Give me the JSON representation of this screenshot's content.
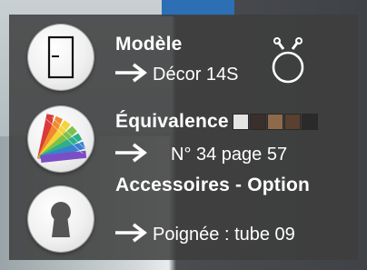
{
  "model": {
    "title": "Modèle",
    "value": "Décor 14S"
  },
  "equivalence": {
    "title": "Équivalence",
    "value": "N° 34 page 57",
    "swatches": [
      "#e4e4e4",
      "#3b2f2c",
      "#8f6a4a",
      "#5a4030",
      "#2a2a2a"
    ]
  },
  "accessories": {
    "title": "Accessoires - Option",
    "value": "Poignée : tube 09"
  },
  "icons": {
    "door": "door-icon",
    "palette": "color-fan-icon",
    "keyhole": "keyhole-icon",
    "ring": "ring-hanger-icon",
    "arrow": "arrow-right-icon"
  }
}
